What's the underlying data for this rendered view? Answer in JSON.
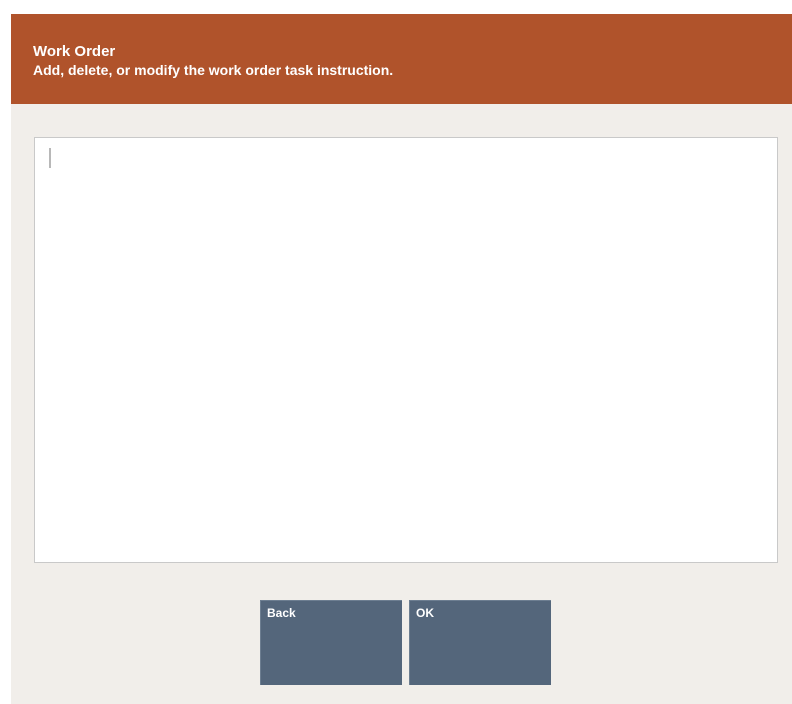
{
  "header": {
    "title": "Work Order",
    "subtitle": "Add, delete, or modify the work order task instruction."
  },
  "task_instruction": {
    "value": ""
  },
  "buttons": {
    "back_label": "Back",
    "ok_label": "OK"
  },
  "colors": {
    "header_background": "#b0532b",
    "dialog_background": "#f1eeea",
    "button_background": "#54667b"
  }
}
